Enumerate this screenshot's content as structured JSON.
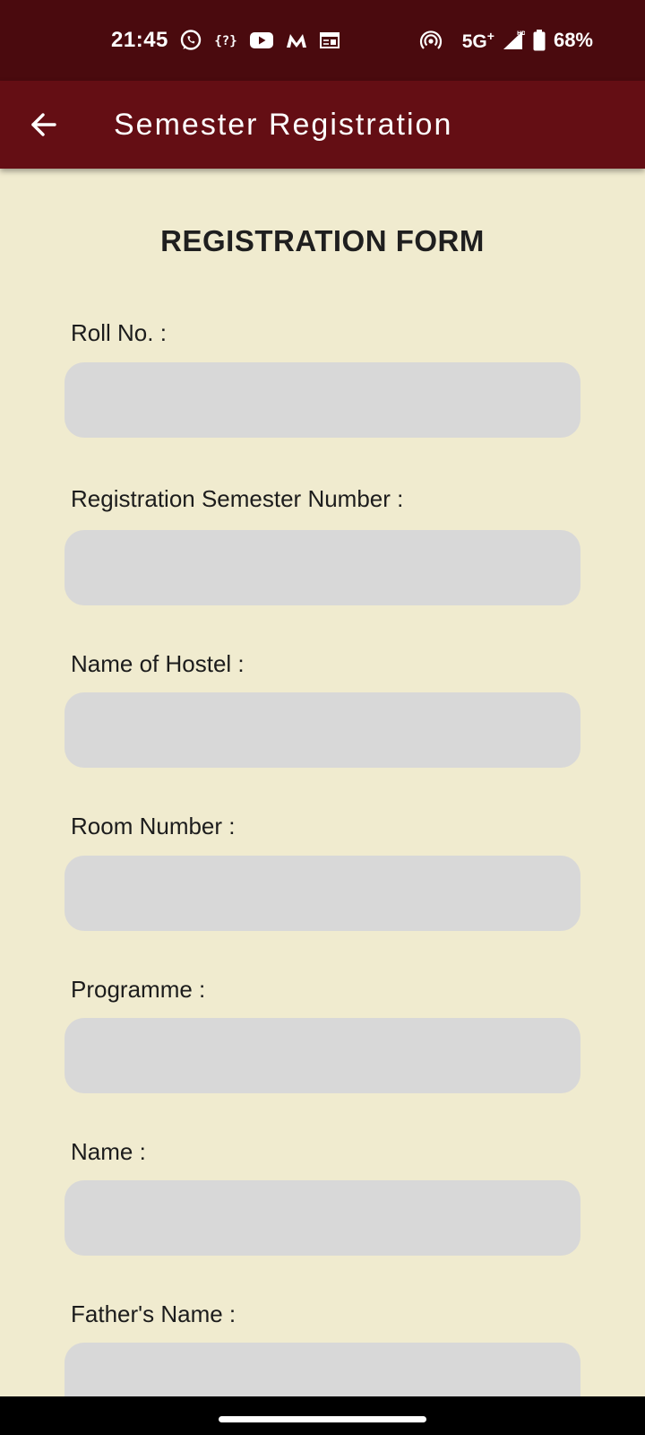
{
  "status_bar": {
    "time": "21:45",
    "notification_icons": [
      "whatsapp-icon",
      "unknown-app-icon",
      "youtube-icon",
      "myntra-icon",
      "news-icon"
    ],
    "hotspot_icon": "hotspot-icon",
    "network": "5G",
    "network_suffix": "+",
    "signal_icon": "signal-icon",
    "battery_icon": "battery-icon",
    "battery": "68%"
  },
  "app_bar": {
    "back_icon": "arrow-left-icon",
    "title": "Semester Registration"
  },
  "form": {
    "title": "REGISTRATION FORM",
    "fields": [
      {
        "label": "Roll No. :",
        "value": "",
        "placeholder": ""
      },
      {
        "label": "Registration Semester Number :",
        "value": "",
        "placeholder": ""
      },
      {
        "label": "Name of Hostel :",
        "value": "",
        "placeholder": ""
      },
      {
        "label": "Room Number :",
        "value": "",
        "placeholder": ""
      },
      {
        "label": "Programme :",
        "value": "",
        "placeholder": ""
      },
      {
        "label": "Name :",
        "value": "",
        "placeholder": ""
      },
      {
        "label": "Father's Name :",
        "value": "",
        "placeholder": ""
      }
    ]
  },
  "colors": {
    "status_bar_bg": "#4a0a0e",
    "app_bar_bg": "#640e14",
    "page_bg": "#f0ebcf",
    "input_bg": "#d8d8d8"
  }
}
